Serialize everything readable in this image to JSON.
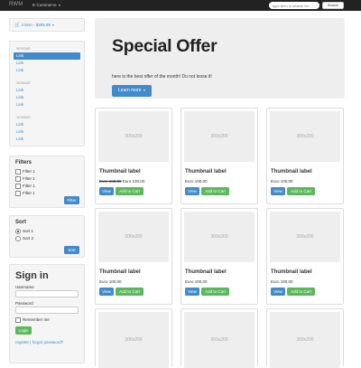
{
  "navbar": {
    "brand": "RWM",
    "menu": "E-Commerce",
    "search_placeholder": "type term to search for...",
    "search_button": "Search"
  },
  "cart": {
    "text": "3 item - $999.99"
  },
  "sidebar": {
    "groups": [
      {
        "header": "SIDEBAR",
        "links": [
          "Link",
          "Link",
          "Link"
        ]
      },
      {
        "header": "SIDEBAR",
        "links": [
          "Link",
          "Link",
          "Link"
        ]
      },
      {
        "header": "SIDEBAR",
        "links": [
          "Link",
          "Link",
          "Link"
        ]
      }
    ]
  },
  "filters": {
    "title": "Filters",
    "items": [
      "Filter 1",
      "Filter 1",
      "Filter 1",
      "Filter 1"
    ],
    "button": "Filter"
  },
  "sort": {
    "title": "Sort",
    "options": [
      "Sort 1",
      "Sort 2"
    ],
    "selected": 0,
    "button": "Sort"
  },
  "signin": {
    "title": "Sign in",
    "username_label": "Username",
    "password_label": "Password",
    "remember_label": "Remember me",
    "login_button": "Login",
    "register_link": "register",
    "separator": "|",
    "forgot_link": "forgot password?"
  },
  "jumbotron": {
    "title": "Special Offer",
    "text": "here is the best offer of the month! Do not loose it!",
    "button": "Learn more"
  },
  "products": [
    {
      "image": "300x200",
      "label": "Thumbnail label",
      "old_price": "Euro 150,00",
      "price": "Euro 100,00",
      "view": "View",
      "add": "Add to Cart"
    },
    {
      "image": "300x200",
      "label": "Thumbnail label",
      "old_price": "",
      "price": "Euro 100,00",
      "view": "View",
      "add": "Add to Cart"
    },
    {
      "image": "300x200",
      "label": "Thumbnail label",
      "old_price": "",
      "price": "Euro 100,00",
      "view": "View",
      "add": "Add to Cart"
    },
    {
      "image": "300x200",
      "label": "Thumbnail label",
      "old_price": "",
      "price": "Euro 100,00",
      "view": "View",
      "add": "Add to Cart"
    },
    {
      "image": "300x200",
      "label": "Thumbnail label",
      "old_price": "",
      "price": "Euro 100,00",
      "view": "View",
      "add": "Add to Cart"
    },
    {
      "image": "300x200",
      "label": "Thumbnail label",
      "old_price": "",
      "price": "Euro 100,00",
      "view": "View",
      "add": "Add to Cart"
    },
    {
      "image": "300x200"
    },
    {
      "image": "300x200"
    },
    {
      "image": "300x200"
    }
  ],
  "colors": {
    "primary": "#428bca",
    "success": "#5cb85c",
    "navbar": "#222222",
    "well": "#f5f5f5",
    "jumbotron": "#eeeeee"
  }
}
